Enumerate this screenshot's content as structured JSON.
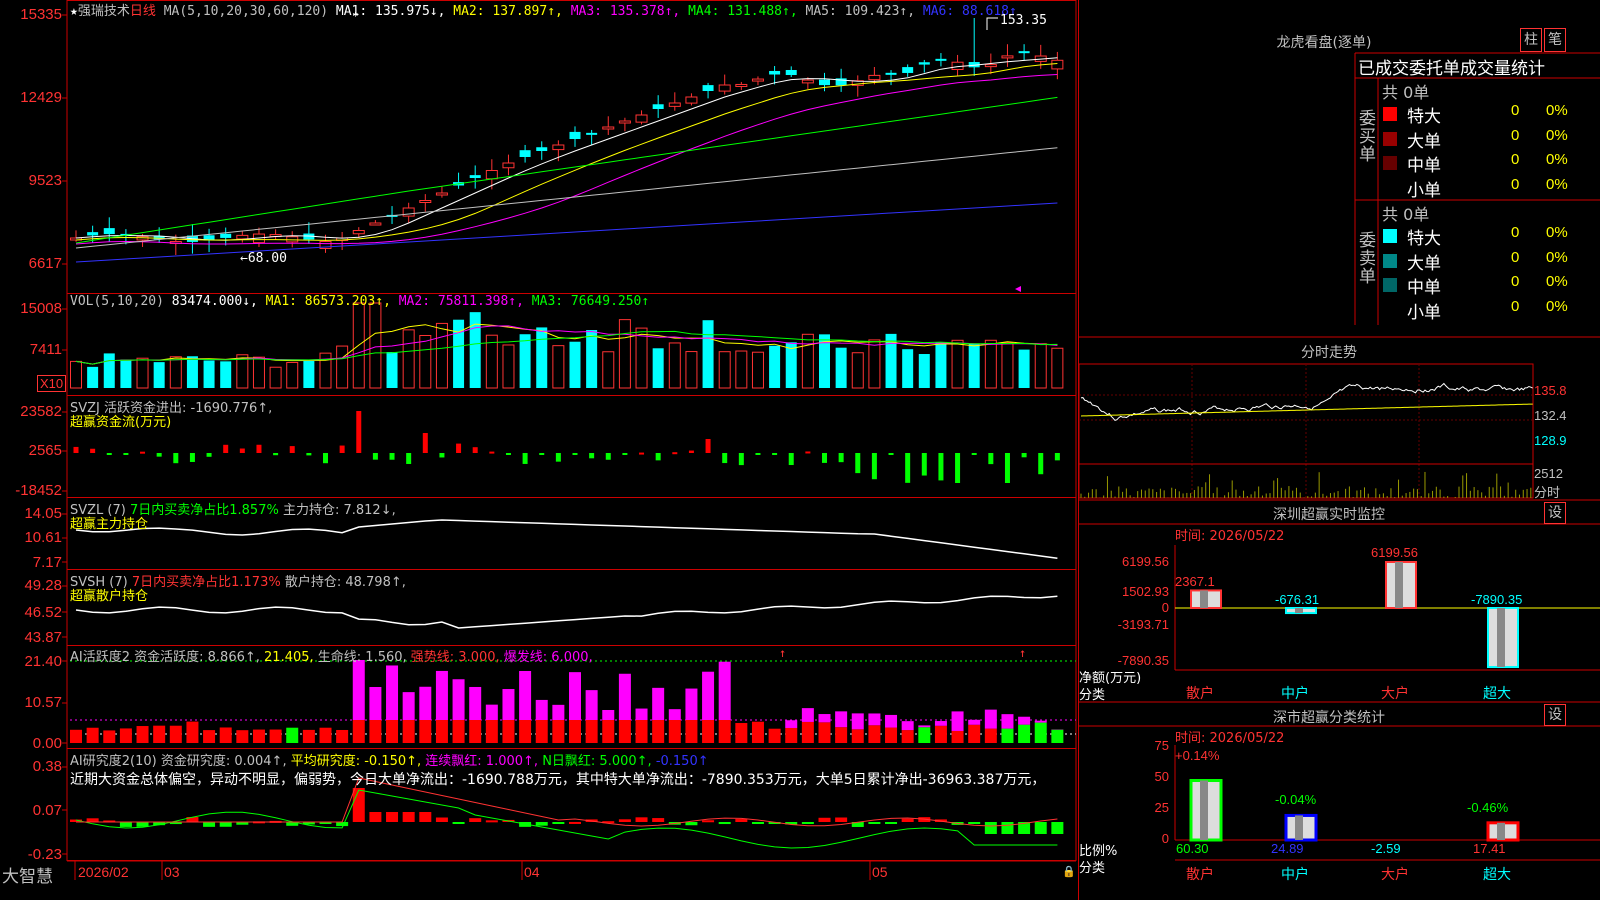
{
  "stock": {
    "star": "★",
    "name": "强瑞技术",
    "period": "日线"
  },
  "colors": {
    "up": "#ff3333",
    "down": "#00ffff",
    "green": "#00ff00",
    "yellow": "#ffff00",
    "magenta": "#ff00ff",
    "white": "#ffffff",
    "blue": "#2222ff",
    "gray": "#aaaaaa",
    "frame": "#cc0000"
  },
  "kline": {
    "legend": [
      {
        "t": "MA(5,10,20,30,60,120)",
        "c": "#c0c0c0"
      },
      {
        "t": "MA1: 135.975↓,",
        "c": "#ffffff"
      },
      {
        "t": "MA2: 137.897↑,",
        "c": "#ffff00"
      },
      {
        "t": "MA3: 135.378↑,",
        "c": "#ff00ff"
      },
      {
        "t": "MA4: 131.488↑,",
        "c": "#00ff00"
      },
      {
        "t": "MA5: 109.423↑,",
        "c": "#c0c0c0"
      },
      {
        "t": "MA6: 88.618↑",
        "c": "#3333ff"
      }
    ],
    "yticks": [
      "15335",
      "12429",
      "9523",
      "6617"
    ],
    "high_label": "153.35",
    "low_label": "68.00"
  },
  "vol": {
    "legend": [
      {
        "t": "VOL(5,10,20)",
        "c": "#c0c0c0"
      },
      {
        "t": "83474.000↓,",
        "c": "#ffffff"
      },
      {
        "t": "MA1: 86573.203↑,",
        "c": "#ffff00"
      },
      {
        "t": "MA2: 75811.398↑,",
        "c": "#ff00ff"
      },
      {
        "t": "MA3: 76649.250↑",
        "c": "#00ff00"
      }
    ],
    "yticks": [
      "15008",
      "7411"
    ],
    "multiplier": "X10"
  },
  "svzj": {
    "legend": [
      {
        "t": "SVZJ  活跃资金进出: -1690.776↑,",
        "c": "#c0c0c0"
      }
    ],
    "sub": "超赢资金流(万元)",
    "yticks": [
      "23582",
      "2565",
      "-18452"
    ]
  },
  "svzl": {
    "legend": [
      {
        "t": "SVZL (7)",
        "c": "#c0c0c0"
      },
      {
        "t": "7日内买卖净占比1.857%",
        "c": "#00ff00"
      },
      {
        "t": "主力持仓: 7.812↓,",
        "c": "#c0c0c0"
      }
    ],
    "sub": "超赢主力持仓",
    "yticks": [
      "14.05",
      "10.61",
      "7.17"
    ]
  },
  "svsh": {
    "legend": [
      {
        "t": "SVSH (7)",
        "c": "#c0c0c0"
      },
      {
        "t": "7日内买卖净占比1.173%",
        "c": "#ff3333"
      },
      {
        "t": "散户持仓: 48.798↑,",
        "c": "#c0c0c0"
      }
    ],
    "sub": "超赢散户持仓",
    "yticks": [
      "49.28",
      "46.52",
      "43.87"
    ]
  },
  "ai1": {
    "legend": [
      {
        "t": "AI活跃度2",
        "c": "#c0c0c0"
      },
      {
        "t": "资金活跃度: 8.866↑,",
        "c": "#c0c0c0"
      },
      {
        "t": "21.405,",
        "c": "#ffff00"
      },
      {
        "t": "生命线: 1.560,",
        "c": "#c0c0c0"
      },
      {
        "t": "强势线: 3.000,",
        "c": "#ff3333"
      },
      {
        "t": "爆发线: 6.000,",
        "c": "#ff00ff"
      }
    ],
    "yticks": [
      "21.40",
      "10.57",
      "0.00"
    ]
  },
  "ai2": {
    "legend": [
      {
        "t": "AI研究度2(10)",
        "c": "#c0c0c0"
      },
      {
        "t": "资金研究度: 0.004↑,",
        "c": "#c0c0c0"
      },
      {
        "t": "平均研究度: -0.150↑,",
        "c": "#ffff00"
      },
      {
        "t": "连续飘红: 1.000↑,",
        "c": "#ff00ff"
      },
      {
        "t": "N日飘红: 5.000↑,",
        "c": "#00ff00"
      },
      {
        "t": "-0.150↑",
        "c": "#3333ff"
      }
    ],
    "comment": "近期大资金总体偏空，异动不明显，偏弱势，今日大单净流出：-1690.788万元，其中特大单净流出：-7890.353万元，大单5日累计净出-36963.387万元，",
    "yticks": [
      "0.38",
      "0.07",
      "-0.23"
    ]
  },
  "footer": {
    "logo": "大智慧",
    "dates": [
      "2026/02",
      "03",
      "04",
      "05"
    ]
  },
  "lhb": {
    "title": "龙虎看盘(逐单)",
    "btn_bar": "柱",
    "btn_pen": "笔",
    "tabs": [
      "已成交",
      "委托单",
      "成交量统计"
    ],
    "buy_side": "委买单",
    "sell_side": "委卖单",
    "buy_total": "共 0单",
    "sell_total": "共 0单",
    "buy_rows": [
      {
        "name": "特大",
        "v": "0",
        "p": "0%",
        "c": "#ff0000"
      },
      {
        "name": "大单",
        "v": "0",
        "p": "0%",
        "c": "#990000"
      },
      {
        "name": "中单",
        "v": "0",
        "p": "0%",
        "c": "#660000"
      },
      {
        "name": "小单",
        "v": "0",
        "p": "0%",
        "c": ""
      }
    ],
    "sell_rows": [
      {
        "name": "特大",
        "v": "0",
        "p": "0%",
        "c": "#00ffff"
      },
      {
        "name": "大单",
        "v": "0",
        "p": "0%",
        "c": "#008888"
      },
      {
        "name": "中单",
        "v": "0",
        "p": "0%",
        "c": "#006666"
      },
      {
        "name": "小单",
        "v": "0",
        "p": "0%",
        "c": ""
      }
    ]
  },
  "intraday": {
    "title": "分时走势",
    "yticks": [
      "135.8",
      "132.4",
      "128.9"
    ],
    "vol_tick": "2512",
    "vol_unit": "分时"
  },
  "monitor": {
    "title": "深圳超赢实时监控",
    "btn": "设",
    "time": "时间: 2026/05/22",
    "yticks": [
      "6199.56",
      "1502.93",
      "0",
      "-3193.71",
      "-7890.35"
    ],
    "bar_labels": [
      "2367.1",
      "-676.31",
      "6199.56",
      "-7890.35"
    ],
    "unit1": "净额(万元)",
    "unit2": "分类",
    "cats": [
      "散户",
      "中户",
      "大户",
      "超大"
    ]
  },
  "classify": {
    "title": "深市超赢分类统计",
    "btn": "设",
    "time": "时间: 2026/05/22",
    "yticks": [
      "75",
      "50",
      "25",
      "0"
    ],
    "top_labels": [
      "+0.14%",
      "-0.04%",
      "-0.46%"
    ],
    "bottom_labels": [
      "60.30",
      "24.89",
      "-2.59",
      "17.41"
    ],
    "unit1": "比例%",
    "unit2": "分类",
    "cats": [
      "散户",
      "中户",
      "大户",
      "超大"
    ]
  }
}
